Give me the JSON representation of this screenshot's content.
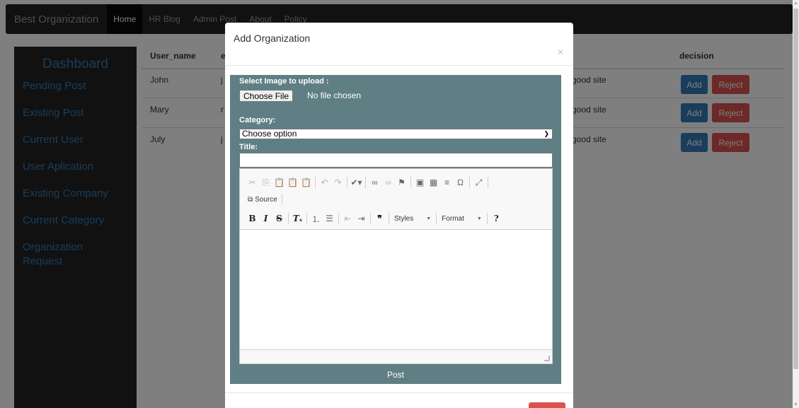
{
  "navbar": {
    "brand": "Best Organization",
    "items": [
      "Home",
      "HR Blog",
      "Admin Post",
      "About",
      "Policy"
    ]
  },
  "sidebar": {
    "title": "Dashboard",
    "items": [
      "Pending Post",
      "Existing Post",
      "Current User",
      "User Aplication",
      "Existing Company",
      "Current Category",
      "Organization Request"
    ]
  },
  "table": {
    "headers": {
      "user_name": "User_name",
      "email": "e",
      "decision": "decision"
    },
    "rows": [
      {
        "user_name": "John",
        "email": "j",
        "comment": "good site"
      },
      {
        "user_name": "Mary",
        "email": "r",
        "comment": "good site"
      },
      {
        "user_name": "July",
        "email": "j",
        "comment": "good site"
      }
    ],
    "add_label": "Add",
    "reject_label": "Reject"
  },
  "modal": {
    "title": "Add Organization",
    "close": "×",
    "image_label": "Select Image to upload :",
    "choose_file": "Choose File",
    "no_file": "No file chosen",
    "category_label": "Category:",
    "category_value": "Choose option",
    "title_label": "Title:",
    "title_value": "",
    "source_label": "Source",
    "styles_label": "Styles",
    "format_label": "Format",
    "post_label": "Post"
  },
  "colors": {
    "navbar": "#222222",
    "link": "#337ab7",
    "add": "#337ab7",
    "reject": "#d9534f",
    "form_panel": "#5f7f85"
  }
}
